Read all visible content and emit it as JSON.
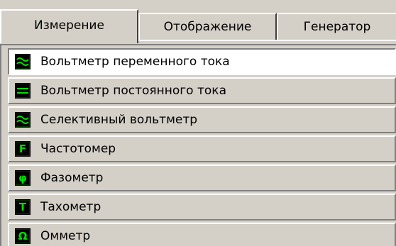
{
  "tabs": [
    {
      "label": "Измерение",
      "active": true
    },
    {
      "label": "Отображение",
      "active": false
    },
    {
      "label": "Генератор",
      "active": false
    }
  ],
  "instruments": [
    {
      "label": "Вольтметр переменного тока",
      "icon": "ac-wave-icon",
      "selected": true
    },
    {
      "label": "Вольтметр постоянного тока",
      "icon": "dc-lines-icon",
      "selected": false
    },
    {
      "label": "Селективный вольтметр",
      "icon": "selective-wave-icon",
      "selected": false
    },
    {
      "label": "Частотомер",
      "icon": "letter-f-icon",
      "glyph": "F",
      "selected": false
    },
    {
      "label": "Фазометр",
      "icon": "phi-icon",
      "glyph": "φ",
      "selected": false
    },
    {
      "label": "Тахометр",
      "icon": "letter-t-icon",
      "glyph": "T",
      "selected": false
    },
    {
      "label": "Омметр",
      "icon": "omega-icon",
      "glyph": "Ω",
      "selected": false
    }
  ],
  "colors": {
    "face": "#d4d0c8",
    "icon_bg": "#000000",
    "icon_fg": "#00e000",
    "selected_bg": "#ffffff"
  }
}
